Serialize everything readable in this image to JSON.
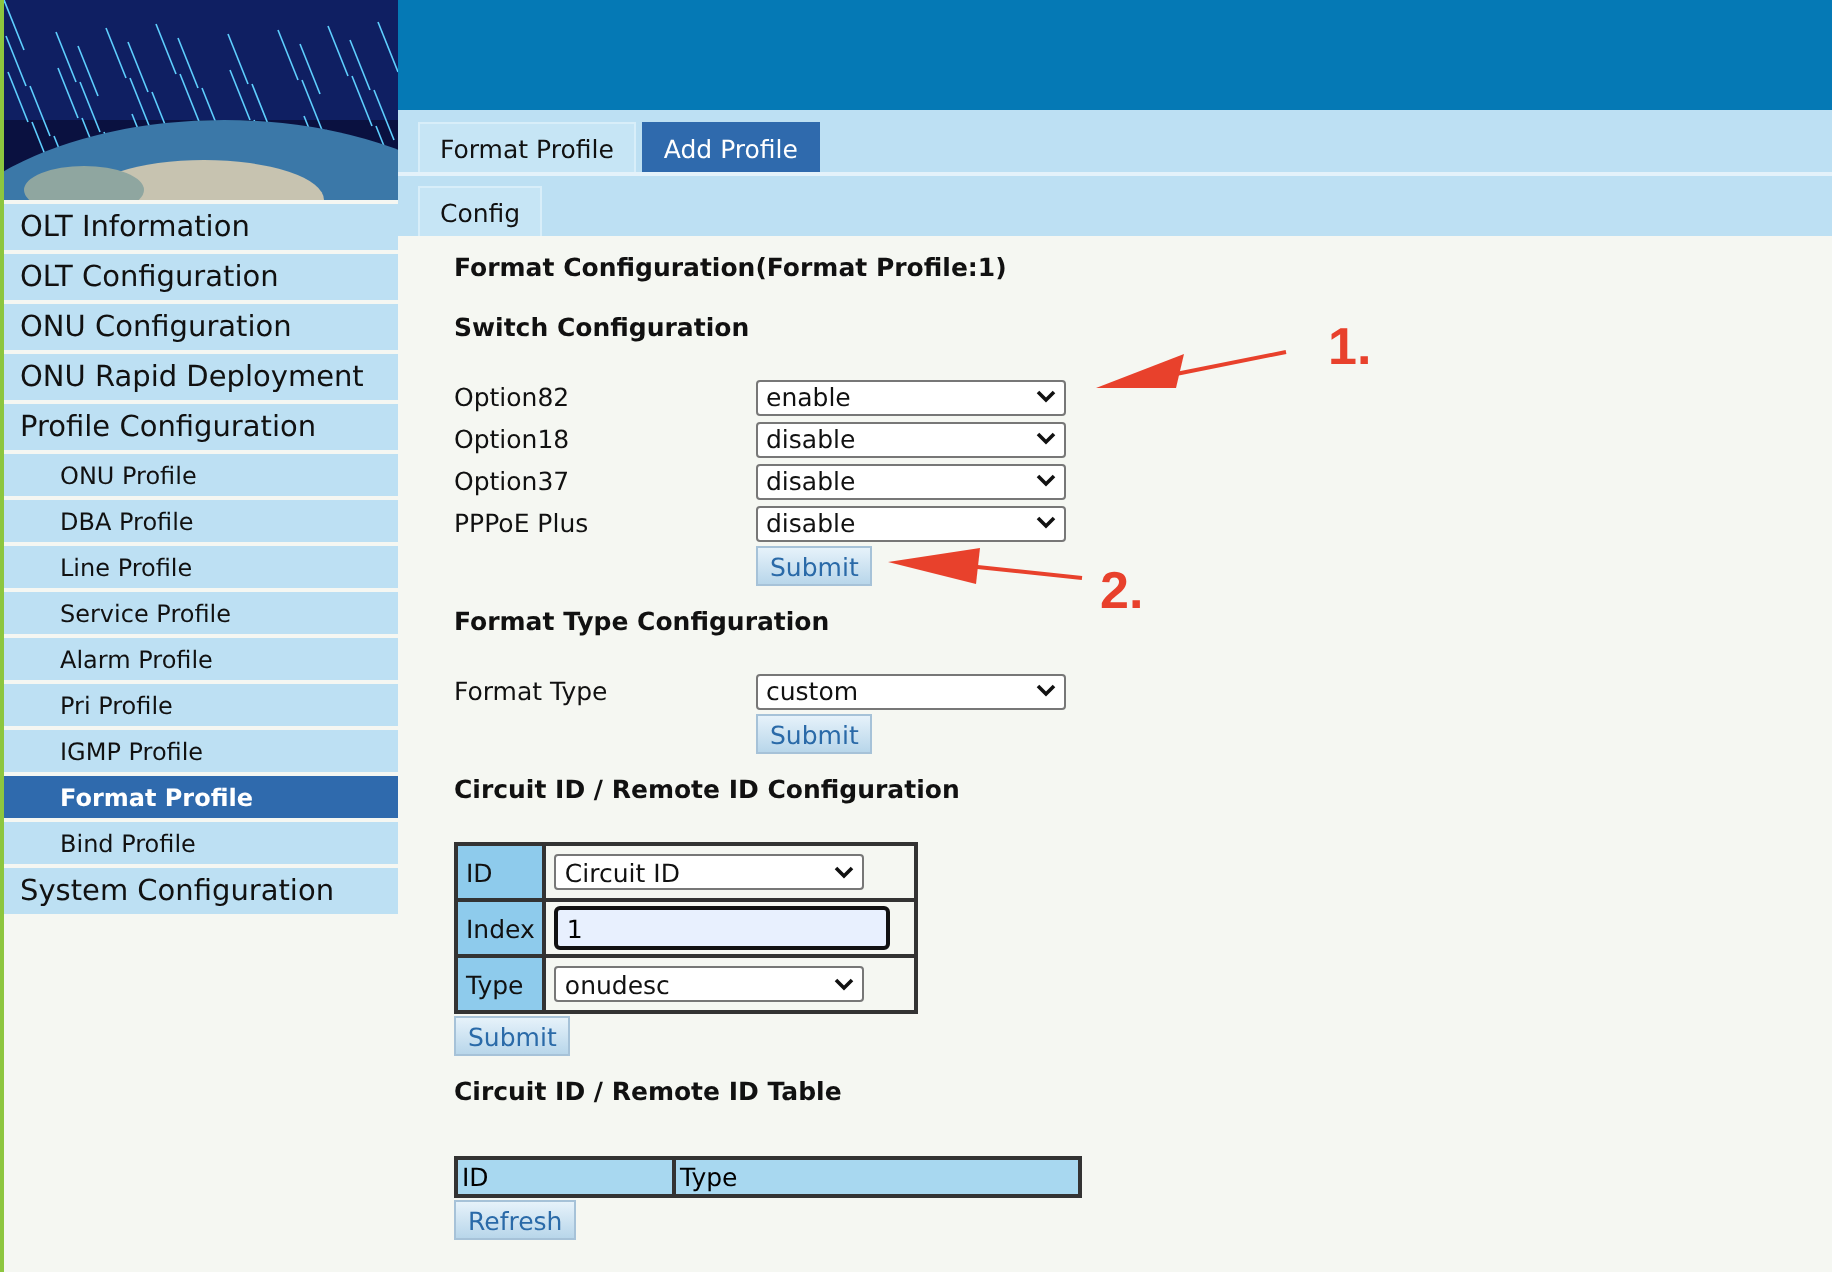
{
  "sidebar": {
    "items": [
      {
        "label": "OLT Information",
        "selected": false
      },
      {
        "label": "OLT Configuration",
        "selected": false
      },
      {
        "label": "ONU Configuration",
        "selected": false
      },
      {
        "label": "ONU Rapid Deployment",
        "selected": false
      },
      {
        "label": "Profile Configuration",
        "selected": false,
        "children": [
          {
            "label": "ONU Profile",
            "selected": false
          },
          {
            "label": "DBA Profile",
            "selected": false
          },
          {
            "label": "Line Profile",
            "selected": false
          },
          {
            "label": "Service Profile",
            "selected": false
          },
          {
            "label": "Alarm Profile",
            "selected": false
          },
          {
            "label": "Pri Profile",
            "selected": false
          },
          {
            "label": "IGMP Profile",
            "selected": false
          },
          {
            "label": "Format Profile",
            "selected": true
          },
          {
            "label": "Bind Profile",
            "selected": false
          }
        ]
      },
      {
        "label": "System Configuration",
        "selected": false
      }
    ]
  },
  "tabs": [
    {
      "label": "Format Profile",
      "selected": true
    },
    {
      "label": "Add Profile",
      "selected": false
    }
  ],
  "subtabs": [
    {
      "label": "Config",
      "selected": true
    }
  ],
  "page_title": "Format Configuration(Format Profile:1)",
  "switch_section": {
    "title": "Switch Configuration",
    "fields": [
      {
        "label": "Option82",
        "value": "enable"
      },
      {
        "label": "Option18",
        "value": "disable"
      },
      {
        "label": "Option37",
        "value": "disable"
      },
      {
        "label": "PPPoE Plus",
        "value": "disable"
      }
    ],
    "button": "Submit"
  },
  "format_type_section": {
    "title": "Format Type Configuration",
    "fields": [
      {
        "label": "Format Type",
        "value": "custom"
      }
    ],
    "button": "Submit"
  },
  "circuit_section": {
    "title": "Circuit ID / Remote ID Configuration",
    "rows": [
      {
        "label": "ID",
        "kind": "select",
        "value": "Circuit ID"
      },
      {
        "label": "Index",
        "kind": "input",
        "value": "1"
      },
      {
        "label": "Type",
        "kind": "select",
        "value": "onudesc"
      }
    ],
    "button": "Submit"
  },
  "circuit_table": {
    "title": "Circuit ID / Remote ID Table",
    "columns": [
      "ID",
      "Type"
    ],
    "button": "Refresh"
  },
  "annotations": [
    {
      "label": "1."
    },
    {
      "label": "2."
    }
  ]
}
